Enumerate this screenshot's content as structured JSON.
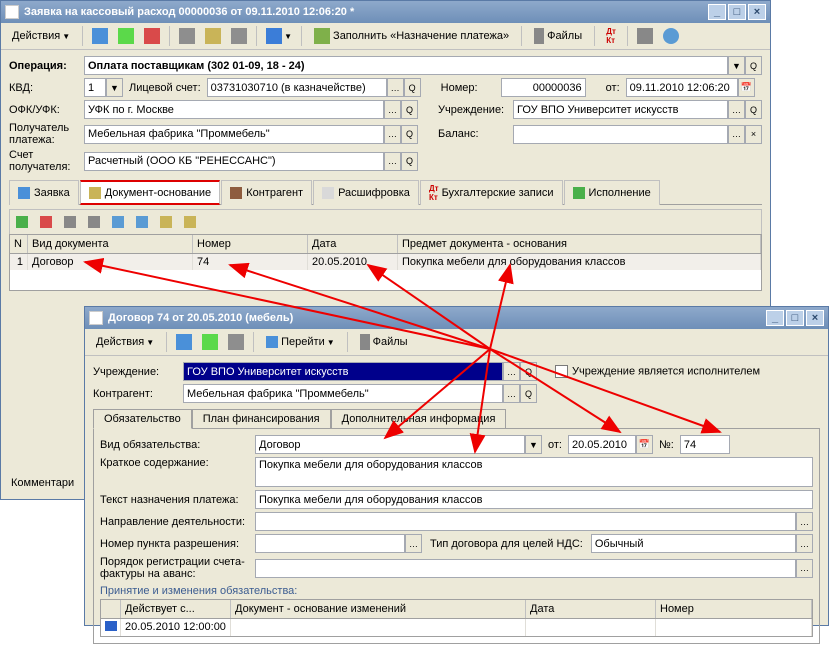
{
  "win1": {
    "title": "Заявка на кассовый расход 00000036 от 09.11.2010 12:06:20 *",
    "toolbar": {
      "actions": "Действия",
      "fill": "Заполнить «Назначение платежа»",
      "files": "Файлы"
    },
    "form": {
      "operation_lbl": "Операция:",
      "operation": "Оплата поставщикам (302 01-09, 18 - 24)",
      "kvd_lbl": "КВД:",
      "kvd": "1",
      "account_lbl": "Лицевой счет:",
      "account": "03731030710 (в казначействе)",
      "number_lbl": "Номер:",
      "number": "00000036",
      "from_lbl": "от:",
      "date": "09.11.2010 12:06:20",
      "ofk_lbl": "ОФК/УФК:",
      "ofk": "УФК по г. Москве",
      "org_lbl": "Учреждение:",
      "org": "ГОУ ВПО Университет искусств",
      "payee_lbl": "Получатель платежа:",
      "payee": "Мебельная фабрика \"Проммебель\"",
      "balance_lbl": "Баланс:",
      "balance": "",
      "payee_acc_lbl": "Счет получателя:",
      "payee_acc": "Расчетный (ООО КБ \"РЕНЕССАНС\")"
    },
    "tabs": [
      "Заявка",
      "Документ-основание",
      "Контрагент",
      "Расшифровка",
      "Бухгалтерские записи",
      "Исполнение"
    ],
    "table": {
      "headers": [
        "N",
        "Вид документа",
        "Номер",
        "Дата",
        "Предмет документа - основания"
      ],
      "rows": [
        {
          "n": "1",
          "kind": "Договор",
          "num": "74",
          "date": "20.05.2010",
          "subj": "Покупка мебели для оборудования классов"
        }
      ]
    },
    "comment_lbl": "Комментари"
  },
  "win2": {
    "title": "Договор 74 от 20.05.2010 (мебель)",
    "toolbar": {
      "actions": "Действия",
      "goto": "Перейти",
      "files": "Файлы"
    },
    "form": {
      "org_lbl": "Учреждение:",
      "org": "ГОУ ВПО Университет искусств",
      "exec_chk": "Учреждение является исполнителем",
      "contr_lbl": "Контрагент:",
      "contr": "Мебельная фабрика \"Проммебель\""
    },
    "tabs": [
      "Обязательство",
      "План финансирования",
      "Дополнительная информация"
    ],
    "detail": {
      "kind_lbl": "Вид обязательства:",
      "kind": "Договор",
      "from_lbl": "от:",
      "date": "20.05.2010",
      "num_lbl": "№:",
      "num": "74",
      "short_lbl": "Краткое содержание:",
      "short": "Покупка мебели для оборудования классов",
      "purpose_lbl": "Текст назначения платежа:",
      "purpose": "Покупка мебели для оборудования классов",
      "dir_lbl": "Направление деятельности:",
      "perm_lbl": "Номер пункта разрешения:",
      "vat_lbl": "Тип договора для целей НДС:",
      "vat": "Обычный",
      "invoice_lbl": "Порядок регистрации счета-фактуры на аванс:"
    },
    "changes": {
      "title": "Принятие и изменения обязательства:",
      "headers": [
        "Действует с...",
        "Документ - основание изменений",
        "Дата",
        "Номер"
      ],
      "row": {
        "date": "20.05.2010 12:00:00"
      }
    }
  }
}
